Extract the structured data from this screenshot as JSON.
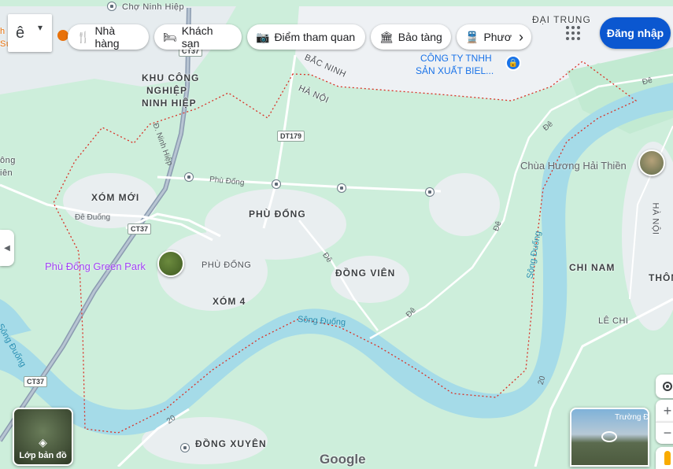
{
  "search": {
    "lang_glyph": "ê",
    "dropdown_glyph": "▾"
  },
  "chips": [
    {
      "label": "Nhà hàng",
      "icon": "fork-knife-icon"
    },
    {
      "label": "Khách sạn",
      "icon": "bed-icon"
    },
    {
      "label": "Điểm tham quan",
      "icon": "camera-icon"
    },
    {
      "label": "Bảo tàng",
      "icon": "museum-icon"
    },
    {
      "label": "Phươ",
      "icon": "transit-icon"
    }
  ],
  "header": {
    "signin_label": "Đăng nhập",
    "chips_next": "›"
  },
  "map": {
    "places": {
      "ninh_hiep_top": "Chợ Ninh Hiệp",
      "dai_trung": "ĐẠI TRUNG",
      "company_line1": "CÔNG TY TNHH",
      "company_line2": "SẢN XUẤT BIEL...",
      "bac_ninh": "BẮC NINH",
      "ha_noi": "HÀ NỘI",
      "kcn_line1": "KHU CÔNG",
      "kcn_line2": "NGHIỆP",
      "kcn_line3": "NINH HIỆP",
      "xom_moi": "XÓM MỚI",
      "phu_dong_upper": "PHÙ ĐỔNG",
      "phu_dong_small": "PHÙ ĐỔNG",
      "dong_vien": "ĐỒNG VIÊN",
      "xom_4": "XÓM 4",
      "chi_nam": "CHI NAM",
      "thon": "THÔN",
      "le_chi": "LÊ CHI",
      "ha_noi_right": "HÀ NỘI",
      "dong_xuyen": "ĐỒNG XUYÊN",
      "left_edge": "ông",
      "left_edge2": "iên",
      "left_cut": "h",
      "left_cut2": "Su",
      "truong_dai_hoc": "Trường Đại Học"
    },
    "pois": {
      "green_park": "Phù Đổng Green Park",
      "chua": "Chùa Hương Hải Thiền"
    },
    "roads": {
      "phu_dong_road": "Phù Đổng",
      "de_duong": "Đê Đuống",
      "d_ninh_hiep": "Đ. Ninh Hiệp",
      "de1": "Đê",
      "de2": "Đê",
      "de3": "Đê",
      "de4": "Đê",
      "de5": "Đê",
      "r20a": "20",
      "r20b": "20"
    },
    "shields": {
      "dt179": "DT179",
      "ct37a": "CT37",
      "ct37b": "CT37",
      "ct37c": "CT37"
    },
    "rivers": {
      "song_duong_center": "Sông Đuống",
      "song_duong_right": "Sông Đuống",
      "song_duong_left": "Sông Đuống"
    },
    "colors": {
      "land": "#cdeedb",
      "urban": "#eef1f4",
      "river": "#a5dbe8",
      "boundary": "#d93025",
      "highway": "#8b9bb0"
    }
  },
  "controls": {
    "layers_label": "Lớp bản đồ",
    "zoom_in": "+",
    "zoom_out": "−",
    "logo": "Google"
  }
}
